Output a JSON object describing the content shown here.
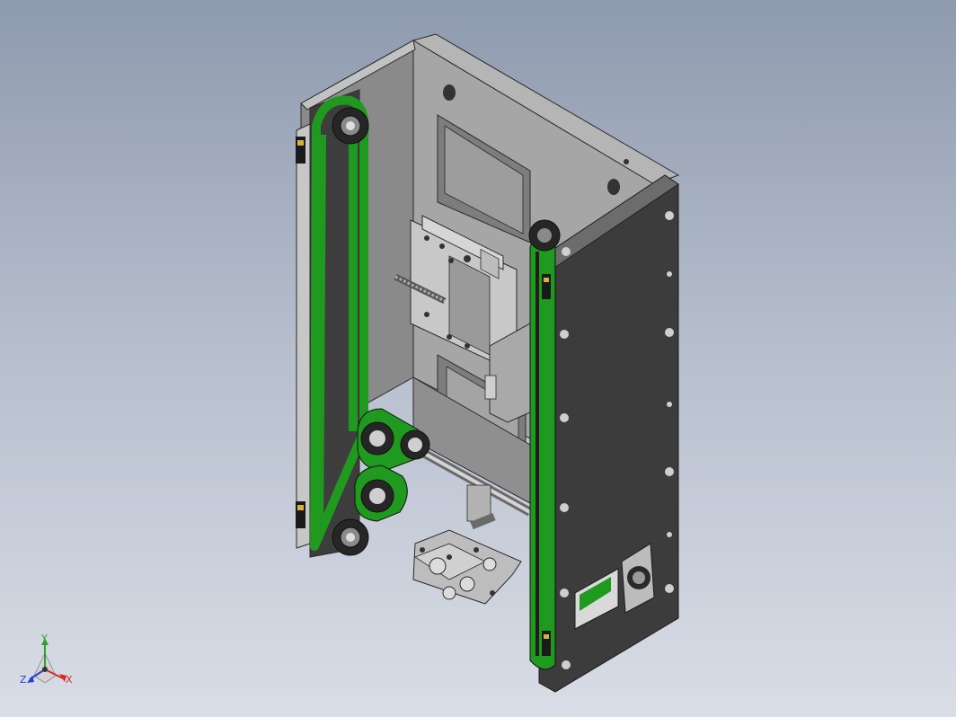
{
  "viewport": {
    "background_top": "#8e9aae",
    "background_bottom": "#d9dde6"
  },
  "model": {
    "frame_color": "#9a9a9a",
    "panel_color": "#3c3c3c",
    "belt_color": "#1f9a1f",
    "metal_color": "#b9b9b9"
  },
  "triad": {
    "x_label": "X",
    "y_label": "Y",
    "z_label": "Z",
    "x_color": "#d42a2a",
    "y_color": "#2aa52a",
    "z_color": "#2a3fd4"
  }
}
